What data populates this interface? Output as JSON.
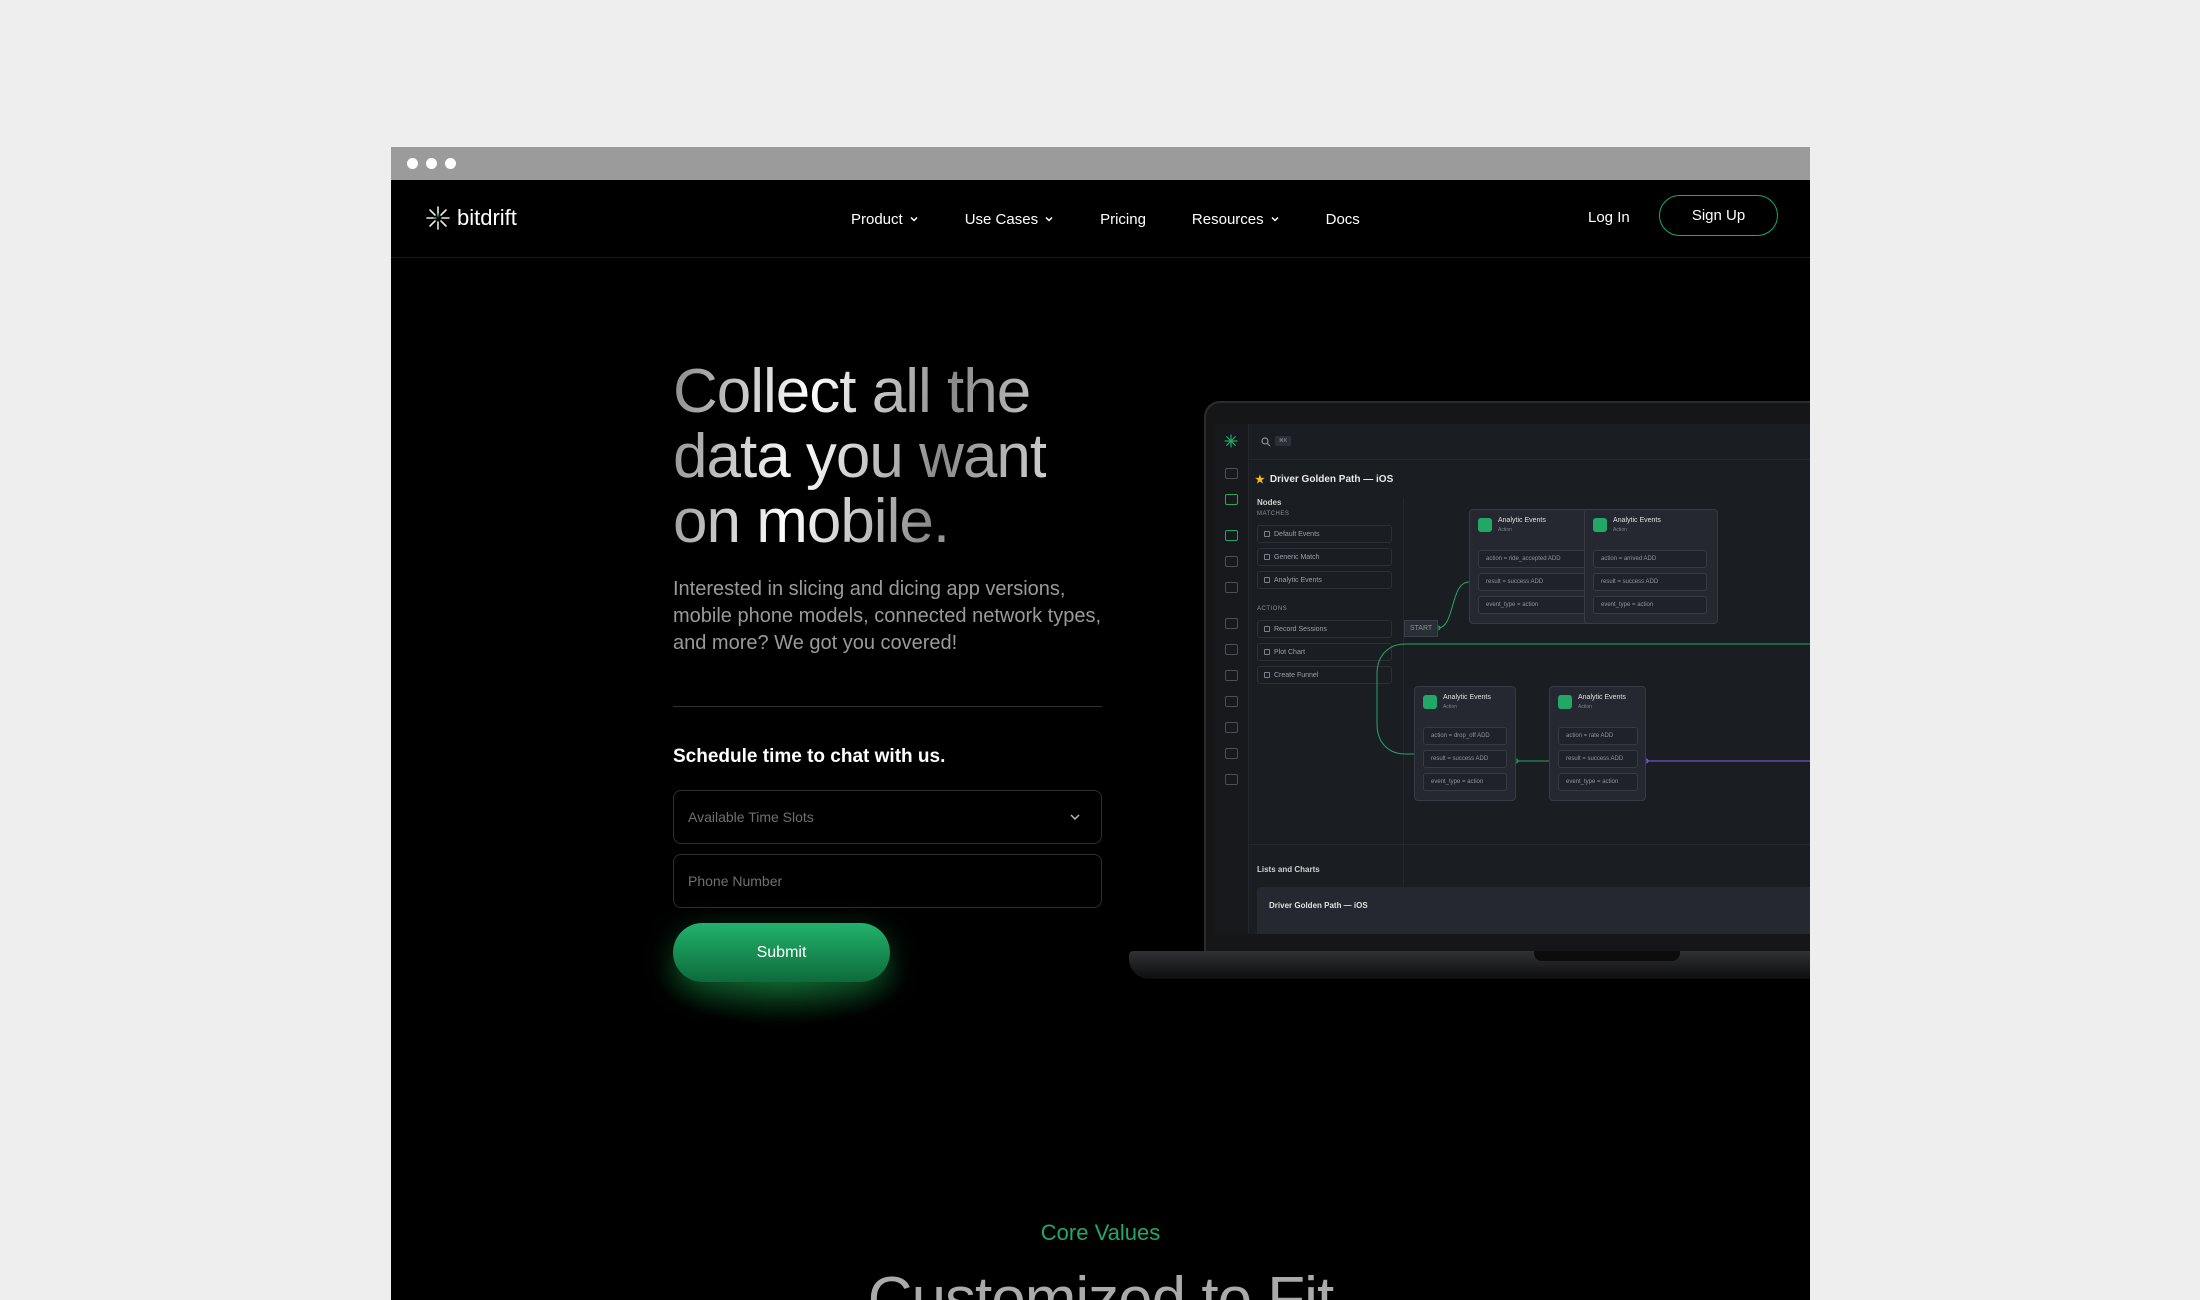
{
  "brand": {
    "name": "bitdrift",
    "accent": "#22a866"
  },
  "nav": {
    "items": [
      {
        "label": "Product",
        "has_dropdown": true
      },
      {
        "label": "Use Cases",
        "has_dropdown": true
      },
      {
        "label": "Pricing",
        "has_dropdown": false
      },
      {
        "label": "Resources",
        "has_dropdown": true
      },
      {
        "label": "Docs",
        "has_dropdown": false
      }
    ],
    "login": "Log In",
    "signup": "Sign Up"
  },
  "hero": {
    "title_lines": [
      "Collect all the",
      "data you want",
      "on mobile."
    ],
    "subtitle": "Interested in slicing and dicing app versions, mobile phone models, connected network types, and more? We got you covered!"
  },
  "form": {
    "heading": "Schedule time to chat with us.",
    "time_slots_placeholder": "Available Time Slots",
    "phone_placeholder": "Phone Number",
    "submit": "Submit"
  },
  "app": {
    "search_badge": "⌘K",
    "workflow_title": "Driver Golden Path — iOS",
    "nodes_heading": "Nodes",
    "matches_label": "MATCHES",
    "matches": [
      "Default Events",
      "Generic Match",
      "Analytic Events"
    ],
    "actions_label": "ACTIONS",
    "actions": [
      "Record Sessions",
      "Plot Chart",
      "Create Funnel"
    ],
    "start_label": "START",
    "cards": [
      {
        "title": "Analytic Events",
        "sub": "Action",
        "rows": [
          "action = ride_accepted  ADD",
          "result = success  ADD",
          "event_type = action"
        ]
      },
      {
        "title": "Analytic Events",
        "sub": "Action",
        "rows": [
          "action = arrived  ADD",
          "result = success  ADD",
          "event_type = action"
        ]
      },
      {
        "title": "Analytic Events",
        "sub": "Action",
        "rows": [
          "action = drop_off  ADD",
          "result = success  ADD",
          "event_type = action"
        ]
      },
      {
        "title": "Analytic Events",
        "sub": "Action",
        "rows": [
          "action = rate  ADD",
          "result = success  ADD",
          "event_type = action"
        ]
      }
    ],
    "lists_heading": "Lists and Charts",
    "lists_card_title": "Driver Golden Path — iOS"
  },
  "section": {
    "eyebrow": "Core Values",
    "heading": "Customized to Fit"
  }
}
